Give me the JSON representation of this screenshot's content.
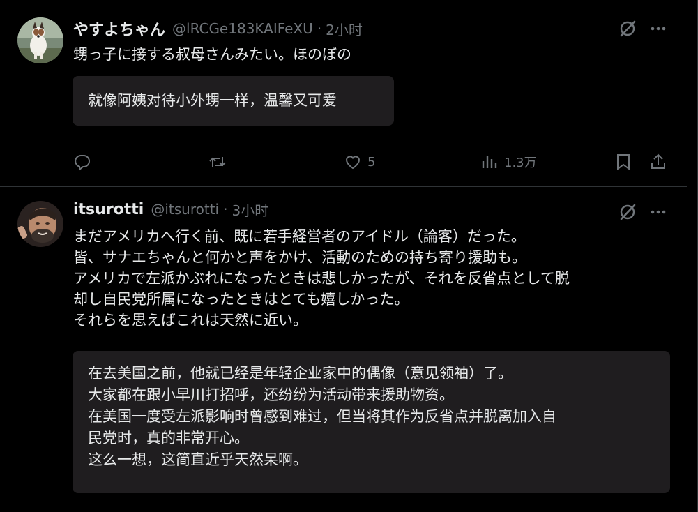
{
  "posts": [
    {
      "author_name": "やすよちゃん",
      "handle": "@lRCGe183KAIFeXU",
      "separator": "·",
      "time": "2小时",
      "text_lines": [
        "甥っ子に接する叔母さんみたい。ほのぼの"
      ],
      "translation_lines": [
        "就像阿姨对待小外甥一样，温馨又可爱"
      ],
      "actions": {
        "reply_count": "",
        "repost_count": "",
        "like_count": "5",
        "views_count": "1.3万"
      },
      "avatar_icon": "dog-photo-avatar"
    },
    {
      "author_name": "itsurotti",
      "handle": "@itsurotti",
      "separator": "·",
      "time": "3小时",
      "text_lines": [
        "まだアメリカへ行く前、既に若手経営者のアイドル（論客）だった。",
        "皆、サナエちゃんと何かと声をかけ、活動のための持ち寄り援助も。",
        "アメリカで左派かぶれになったときは悲しかったが、それを反省点として脱",
        "却し自民党所属になったときはとても嬉しかった。",
        "それらを思えばこれは天然に近い。"
      ],
      "translation_lines": [
        "在去美国之前，他就已经是年轻企业家中的偶像（意见领袖）了。",
        "大家都在跟小早川打招呼，还纷纷为活动带来援助物资。",
        "在美国一度受左派影响时曾感到难过，但当将其作为反省点并脱离加入自",
        "民党时，真的非常开心。",
        "这么一想，这简直近乎天然呆啊。"
      ],
      "avatar_icon": "man-photo-avatar"
    }
  ],
  "colors": {
    "background": "#000000",
    "text": "#e7e9ea",
    "muted": "#71767b",
    "divider": "#2f3336",
    "translation_box": "#1f1d1f"
  }
}
